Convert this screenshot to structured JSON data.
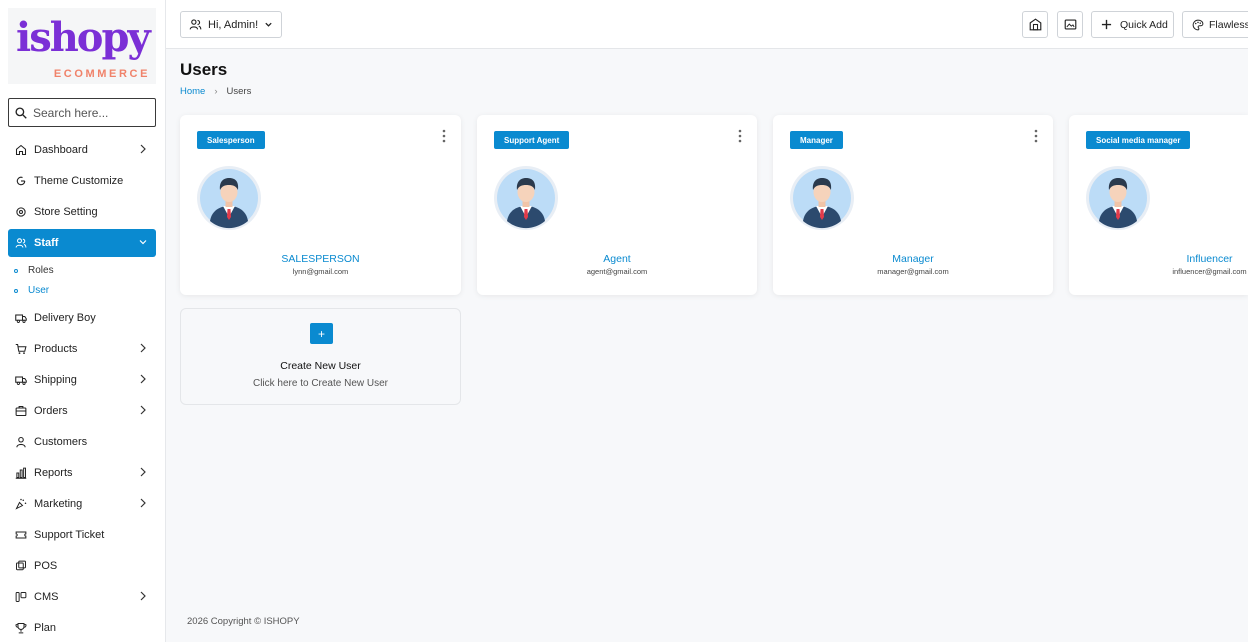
{
  "brand": {
    "logo_main": "ishopy",
    "logo_sub": "ECOMMERCE",
    "primary_color": "#0a8ad0",
    "logo_color": "#7b2fd6",
    "logo_sub_color": "#f0826a"
  },
  "sidebar": {
    "search_placeholder": "Search here...",
    "items": [
      {
        "label": "Dashboard",
        "icon": "home-icon",
        "has_submenu": true
      },
      {
        "label": "Theme Customize",
        "icon": "theme-icon",
        "has_submenu": false
      },
      {
        "label": "Store Setting",
        "icon": "settings-icon",
        "has_submenu": false
      },
      {
        "label": "Staff",
        "icon": "users-icon",
        "has_submenu": true,
        "active": true
      },
      {
        "label": "Delivery Boy",
        "icon": "truck-icon",
        "has_submenu": false
      },
      {
        "label": "Products",
        "icon": "cart-icon",
        "has_submenu": true
      },
      {
        "label": "Shipping",
        "icon": "shipping-icon",
        "has_submenu": true
      },
      {
        "label": "Orders",
        "icon": "orders-icon",
        "has_submenu": true
      },
      {
        "label": "Customers",
        "icon": "user-icon",
        "has_submenu": false
      },
      {
        "label": "Reports",
        "icon": "chart-icon",
        "has_submenu": true
      },
      {
        "label": "Marketing",
        "icon": "marketing-icon",
        "has_submenu": true
      },
      {
        "label": "Support Ticket",
        "icon": "ticket-icon",
        "has_submenu": false
      },
      {
        "label": "POS",
        "icon": "pos-icon",
        "has_submenu": false
      },
      {
        "label": "CMS",
        "icon": "cms-icon",
        "has_submenu": true
      },
      {
        "label": "Plan",
        "icon": "trophy-icon",
        "has_submenu": false
      }
    ],
    "staff_submenu": [
      {
        "label": "Roles",
        "active": false
      },
      {
        "label": "User",
        "active": true
      }
    ]
  },
  "topbar": {
    "greeting": "Hi, Admin!",
    "quick_add": "Quick Add",
    "theme_label": "Flawless"
  },
  "page": {
    "title": "Users",
    "breadcrumb_home": "Home",
    "breadcrumb_current": "Users"
  },
  "users": [
    {
      "role": "Salesperson",
      "name": "SALESPERSON",
      "email": "lynn@gmail.com"
    },
    {
      "role": "Support Agent",
      "name": "Agent",
      "email": "agent@gmail.com"
    },
    {
      "role": "Manager",
      "name": "Manager",
      "email": "manager@gmail.com"
    },
    {
      "role": "Social media manager",
      "name": "Influencer",
      "email": "influencer@gmail.com"
    }
  ],
  "create": {
    "plus": "+",
    "title": "Create New User",
    "subtitle": "Click here to Create New User"
  },
  "footer": {
    "copyright": "2026 Copyright © ISHOPY"
  }
}
